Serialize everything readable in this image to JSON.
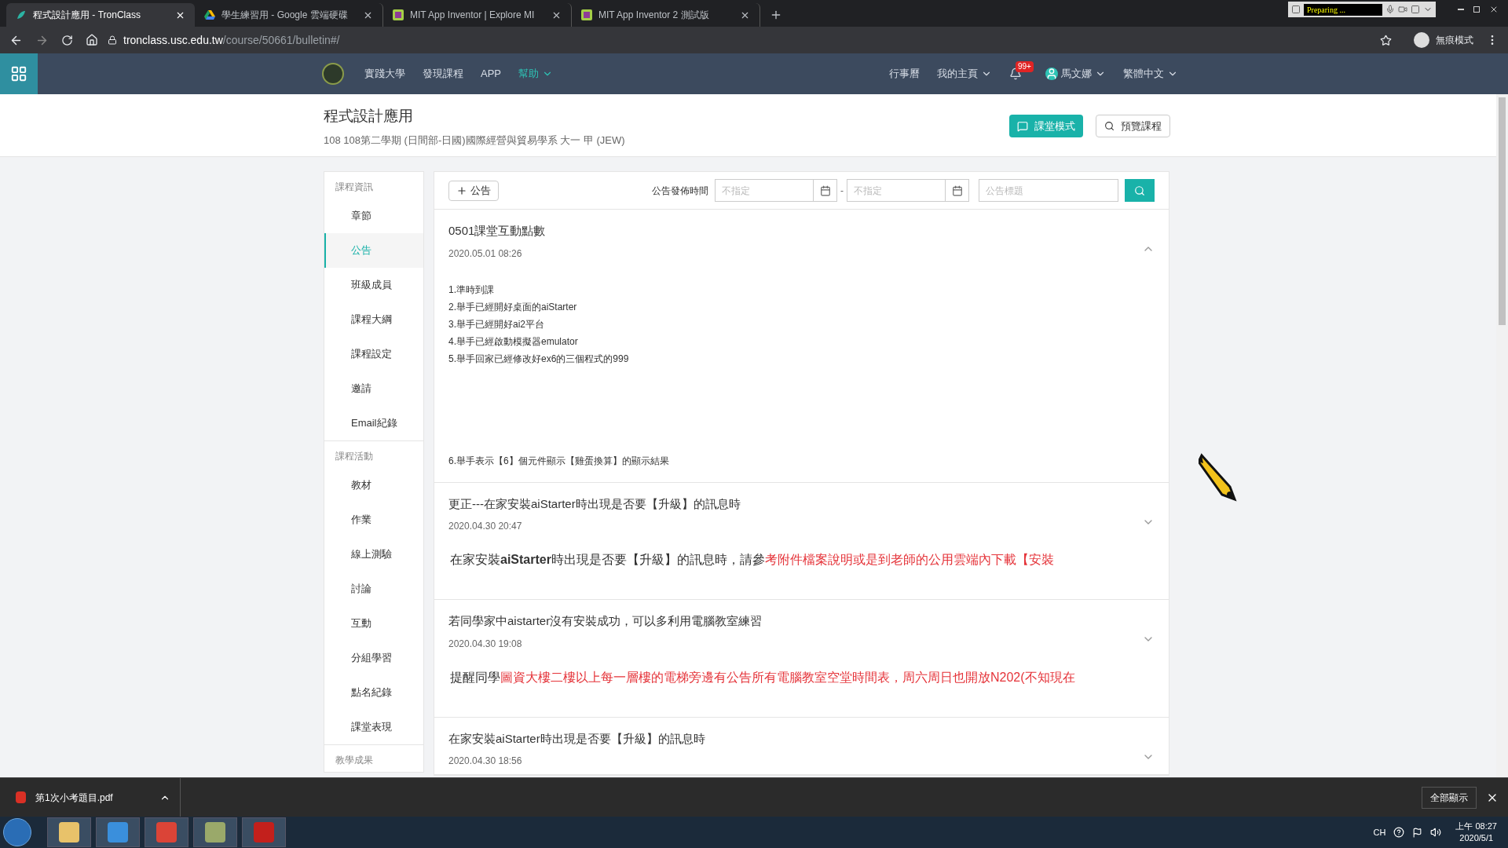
{
  "browser": {
    "tabs": [
      {
        "title": "程式設計應用 - TronClass",
        "kind": "tronclass",
        "selected": true
      },
      {
        "title": "學生練習用 - Google 雲端硬碟",
        "kind": "drive",
        "selected": false
      },
      {
        "title": "MIT App Inventor | Explore MI",
        "kind": "appinventor",
        "selected": false
      },
      {
        "title": "MIT App Inventor 2 測試版",
        "kind": "appinventor",
        "selected": false
      }
    ],
    "recorder_status": "Preparing ...",
    "address": {
      "host": "tronclass.usc.edu.tw",
      "path": "/course/50661/bulletin#/"
    },
    "profile_label": "無痕模式"
  },
  "nav": {
    "left": [
      {
        "label": "實踐大學",
        "selected": false,
        "dropdown": false
      },
      {
        "label": "發現課程",
        "selected": false,
        "dropdown": false
      },
      {
        "label": "APP",
        "selected": false,
        "dropdown": false
      },
      {
        "label": "幫助",
        "selected": true,
        "dropdown": true
      }
    ],
    "calendar": "行事曆",
    "home": "我的主頁",
    "notification_count": "99+",
    "user": "馬文娜",
    "language": "繁體中文"
  },
  "course": {
    "title": "程式設計應用",
    "subtitle": "108 108第二學期 (日間部-日國)國際經營與貿易學系 大一 甲 (JEW)",
    "buttons": [
      {
        "label": "課堂模式",
        "kind": "primary"
      },
      {
        "label": "預覽課程",
        "kind": "secondary"
      }
    ]
  },
  "sidebar": [
    {
      "heading": "課程資訊",
      "items": [
        {
          "label": "章節",
          "selected": false
        },
        {
          "label": "公告",
          "selected": true
        },
        {
          "label": "班級成員",
          "selected": false
        },
        {
          "label": "課程大綱",
          "selected": false
        },
        {
          "label": "課程設定",
          "selected": false
        },
        {
          "label": "邀請",
          "selected": false
        },
        {
          "label": "Email紀錄",
          "selected": false
        }
      ]
    },
    {
      "heading": "課程活動",
      "items": [
        {
          "label": "教材",
          "selected": false
        },
        {
          "label": "作業",
          "selected": false
        },
        {
          "label": "線上測驗",
          "selected": false
        },
        {
          "label": "討論",
          "selected": false
        },
        {
          "label": "互動",
          "selected": false
        },
        {
          "label": "分組學習",
          "selected": false
        },
        {
          "label": "點名紀錄",
          "selected": false
        },
        {
          "label": "課堂表現",
          "selected": false
        }
      ]
    },
    {
      "heading": "教學成果"
    }
  ],
  "toolbar": {
    "add_label": "公告",
    "filter_label": "公告發佈時間",
    "start_placeholder": "不指定",
    "separator": "-",
    "end_placeholder": "不指定",
    "title_placeholder": "公告標題"
  },
  "announcements": [
    {
      "title": "0501課堂互動點數",
      "date": "2020.05.01 08:26",
      "expanded": true,
      "kind": "list",
      "blocks": [
        [
          "1.準時到課",
          "2.舉手已經開好桌面的aiStarter",
          "3.舉手已經開好ai2平台",
          "4.舉手已經啟動模擬器emulator",
          "5.舉手回家已經修改好ex6的三個程式的999"
        ],
        [
          "6.舉手表示【6】個元件顯示【雞蛋換算】的顯示結果"
        ]
      ]
    },
    {
      "title": "更正---在家安裝aiStarter時出現是否要【升級】的訊息時",
      "date": "2020.04.30 20:47",
      "expanded": false,
      "kind": "preview",
      "parts": [
        {
          "text": "在家安裝**aiStarter**時出現是否要【升級】的訊息時，請參",
          "highlight": false
        },
        {
          "text": "考附件檔案說明或是到老師的公用雲端內下載【安裝",
          "highlight": true
        }
      ]
    },
    {
      "title": "若同學家中aistarter沒有安裝成功，可以多利用電腦教室練習",
      "date": "2020.04.30 19:08",
      "expanded": false,
      "kind": "preview",
      "parts": [
        {
          "text": "提醒同學",
          "highlight": false
        },
        {
          "text": "圖資大樓二樓以上每一層樓的電梯旁邊有公告所有電腦教室空堂時間表，周六周日也開放N202(不知現在",
          "highlight": true
        }
      ]
    },
    {
      "title": "在家安裝aiStarter時出現是否要【升級】的訊息時",
      "date": "2020.04.30 18:56",
      "expanded": false,
      "kind": "preview"
    }
  ],
  "download_bar": {
    "file": "第1次小考題目.pdf",
    "show_all": "全部顯示"
  },
  "taskbar": {
    "language": "CH",
    "time": "上午 08:27",
    "date": "2020/5/1"
  }
}
